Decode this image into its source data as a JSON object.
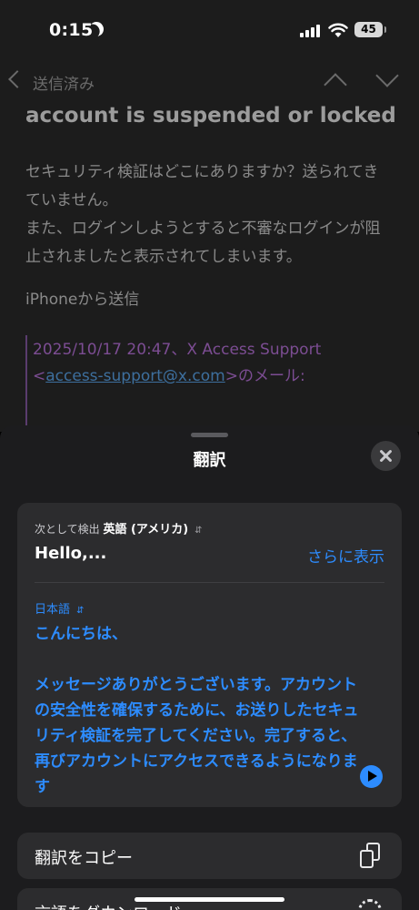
{
  "status_bar": {
    "time": "0:15",
    "battery": "45"
  },
  "email": {
    "back_label": "送信済み",
    "subject": "account is suspended or locked",
    "body": "セキュリティ検証はどこにありますか？送られてきていません。\nまた、ログインしようとすると不審なログインが阻止されましたと表示されてしまいます。",
    "signature": "iPhoneから送信",
    "quote_header": "2025/10/17 20:47、X Access Support",
    "quote_open": "<",
    "quote_email": "access-support@x.com",
    "quote_suffix": ">のメール:"
  },
  "sheet": {
    "title": "翻訳",
    "detected_prefix": "次として検出",
    "detected_language": "英語 (アメリカ)",
    "source_text": "Hello,...",
    "show_more": "さらに表示",
    "target_language": "日本語",
    "target_greeting": "こんにちは、",
    "target_body": "メッセージありがとうございます。アカウントの安全性を確保するために、お送りしたセキュリティ検証を完了してください。完了すると、再びアカウントにアクセスできるようになります",
    "copy_label": "翻訳をコピー",
    "download_label": "言語をダウンロード"
  },
  "colors": {
    "accent": "#2d8cff",
    "sheet_bg": "#1c1c1e",
    "card_bg": "#2c2c2e"
  }
}
